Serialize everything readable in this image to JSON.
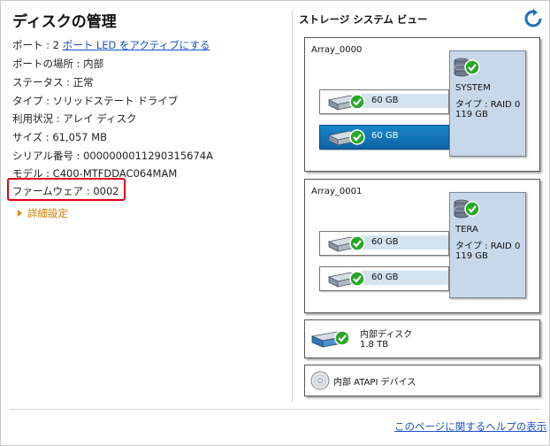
{
  "details": {
    "title": "ディスクの管理",
    "port_label": "ポート : 2",
    "port_link": "ポート LED をアクティブにする",
    "location": "ポートの場所 : 内部",
    "status": "ステータス : 正常",
    "type": "タイプ : ソリッドステート ドライブ",
    "usage": "利用状況 : アレイ ディスク",
    "size": "サイズ : 61,057 MB",
    "serial": "シリアル番号 : 0000000011290315674A",
    "model": "モデル : C400-MTFDDAC064MAM",
    "firmware": "ファームウェア : 0002",
    "advanced": "詳細設定"
  },
  "storage": {
    "title": "ストレージ システム ビュー",
    "arrays": [
      {
        "name": "Array_0000",
        "disks": [
          {
            "size": "60 GB",
            "selected": false
          },
          {
            "size": "60 GB",
            "selected": true
          }
        ],
        "volume": {
          "name": "SYSTEM",
          "type": "タイプ : RAID 0",
          "size": "119 GB"
        }
      },
      {
        "name": "Array_0001",
        "disks": [
          {
            "size": "60 GB",
            "selected": false
          },
          {
            "size": "60 GB",
            "selected": false
          }
        ],
        "volume": {
          "name": "TERA",
          "type": "タイプ : RAID 0",
          "size": "119 GB"
        }
      }
    ],
    "internal_disk": {
      "name": "内部ディスク",
      "size": "1.8 TB"
    },
    "atapi": {
      "name": "内部 ATAPI デバイス"
    }
  },
  "footer": {
    "help": "このページに関するヘルプの表示"
  },
  "colors": {
    "accent": "#1a86c9",
    "highlight": "#e0001a",
    "link": "#1a52c8",
    "check": "#27a827",
    "volume_bg": "#c7d8ea"
  }
}
